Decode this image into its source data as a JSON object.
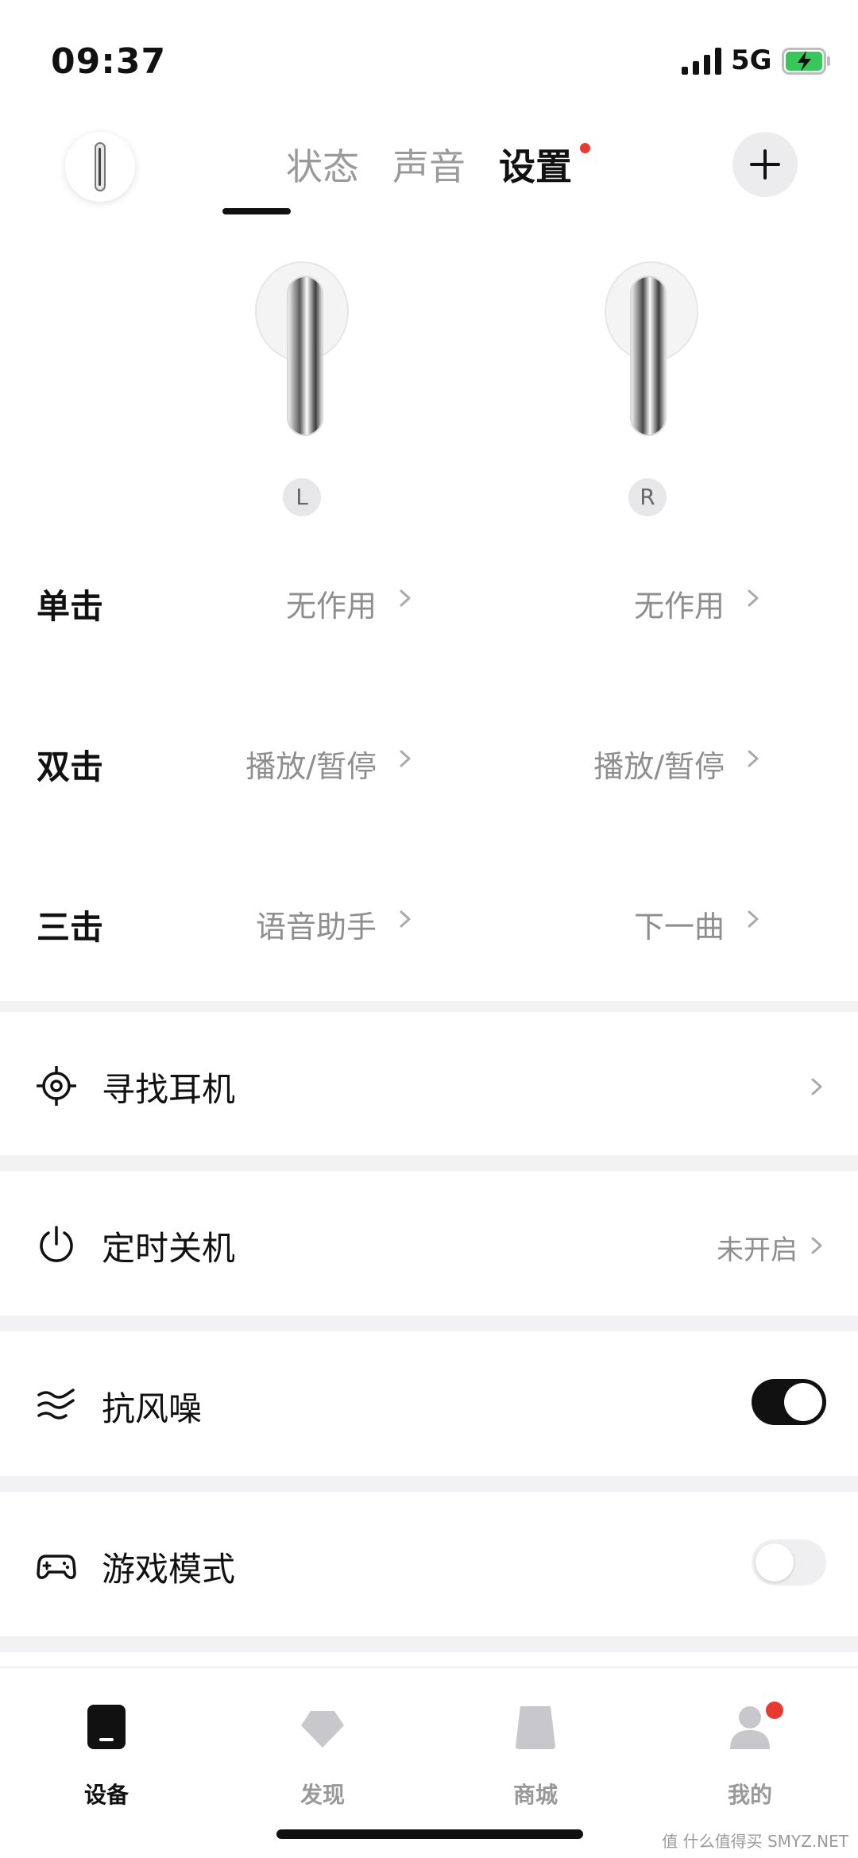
{
  "status_bar": {
    "time": "09:37",
    "network": "5G"
  },
  "header": {
    "tabs": [
      {
        "label": "状态"
      },
      {
        "label": "声音"
      },
      {
        "label": "设置"
      }
    ],
    "active_tab_index": 2
  },
  "earbuds": {
    "left_label": "L",
    "right_label": "R"
  },
  "gestures": [
    {
      "label": "单击",
      "left_value": "无作用",
      "right_value": "无作用"
    },
    {
      "label": "双击",
      "left_value": "播放/暂停",
      "right_value": "播放/暂停"
    },
    {
      "label": "三击",
      "left_value": "语音助手",
      "right_value": "下一曲"
    }
  ],
  "settings": {
    "find_earbuds": {
      "label": "寻找耳机"
    },
    "auto_off": {
      "label": "定时关机",
      "value": "未开启"
    },
    "wind_noise": {
      "label": "抗风噪",
      "enabled": true
    },
    "game_mode": {
      "label": "游戏模式",
      "enabled": false
    }
  },
  "bottom_nav": [
    {
      "label": "设备"
    },
    {
      "label": "发现"
    },
    {
      "label": "商城"
    },
    {
      "label": "我的"
    }
  ],
  "watermark": "值 什么值得买 SMYZ.NET",
  "colors": {
    "accent": "#111111",
    "notification_dot": "#e83a2f",
    "muted_text": "#8e8e8e",
    "separator": "#f2f2f4"
  }
}
